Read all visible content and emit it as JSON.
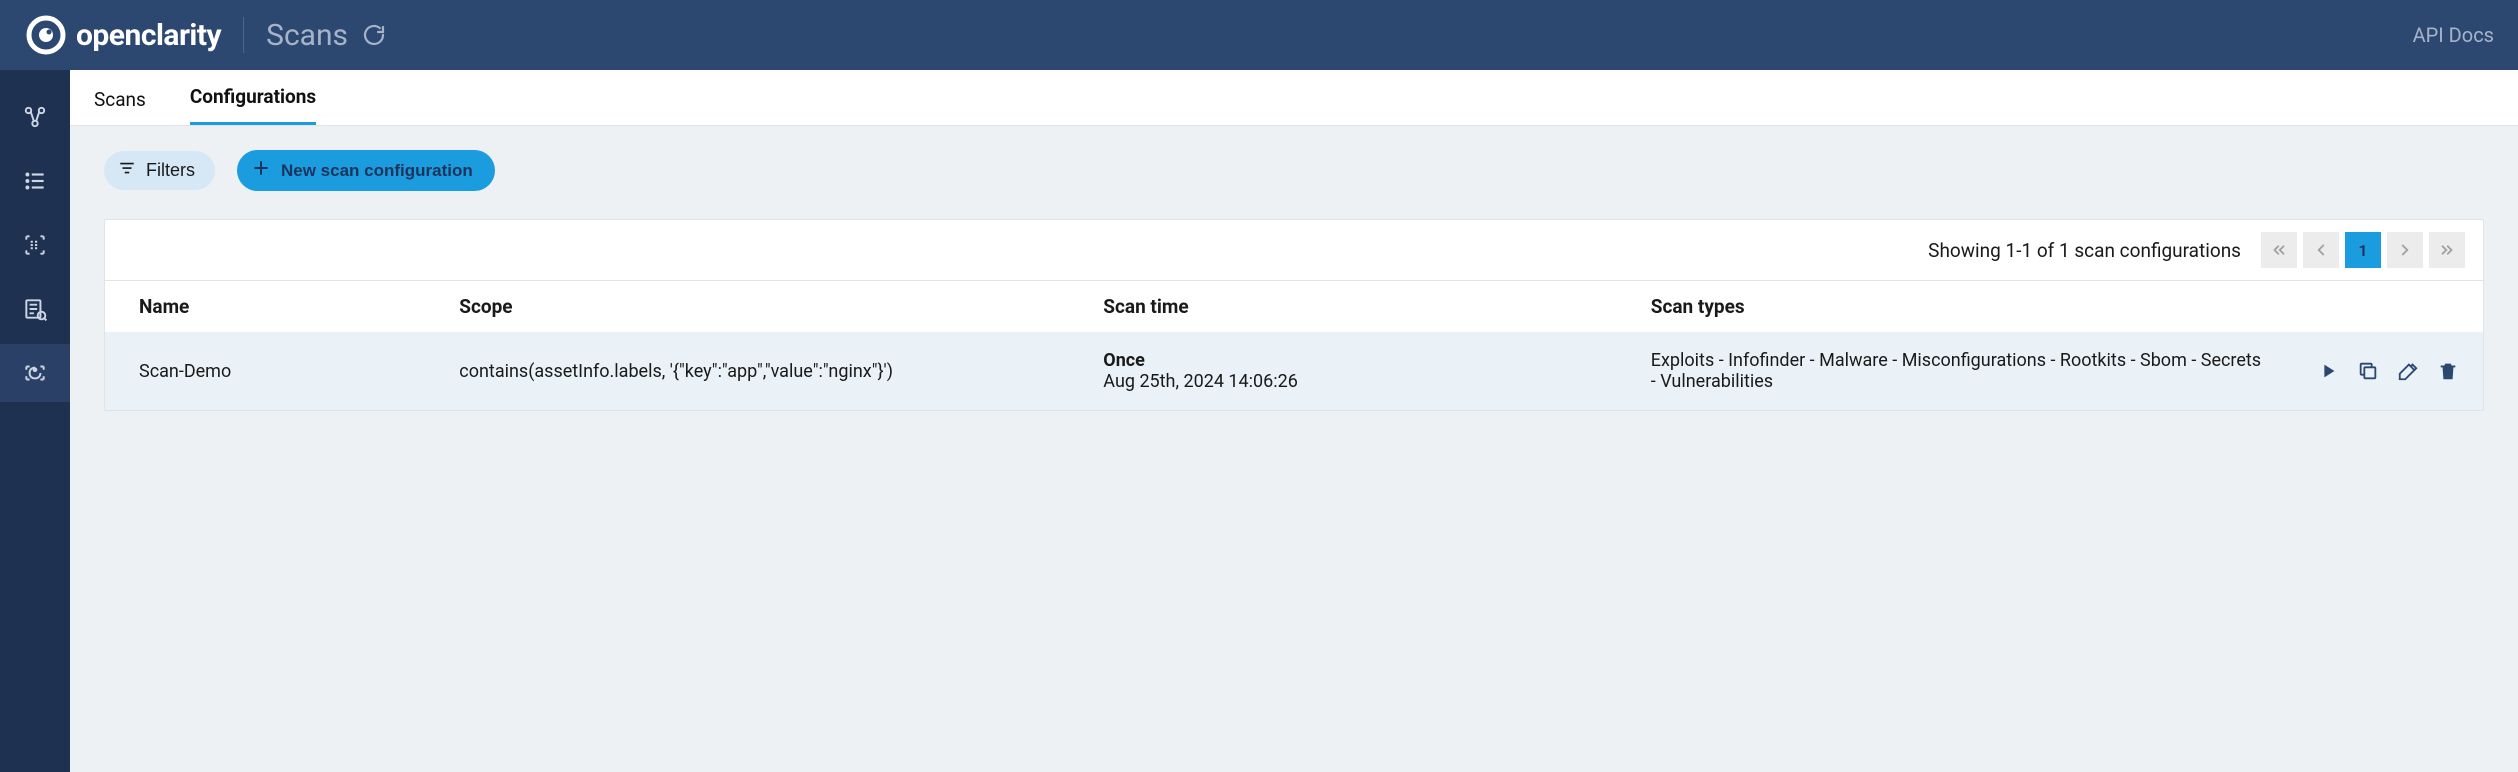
{
  "header": {
    "brand": "openclarity",
    "breadcrumb": "Scans",
    "api_docs": "API Docs"
  },
  "tabs": {
    "scans": "Scans",
    "configurations": "Configurations"
  },
  "toolbar": {
    "filters_label": "Filters",
    "new_scan_label": "New scan configuration"
  },
  "table": {
    "showing": "Showing 1-1 of 1 scan configurations",
    "current_page": "1",
    "columns": {
      "name": "Name",
      "scope": "Scope",
      "scan_time": "Scan time",
      "scan_types": "Scan types"
    },
    "rows": [
      {
        "name": "Scan-Demo",
        "scope": "contains(assetInfo.labels, '{\"key\":\"app\",\"value\":\"nginx\"}')",
        "scan_time_mode": "Once",
        "scan_time_ts": "Aug 25th, 2024 14:06:26",
        "scan_types": "Exploits - Infofinder - Malware - Misconfigurations - Rootkits - Sbom - Secrets - Vulnerabilities"
      }
    ]
  }
}
